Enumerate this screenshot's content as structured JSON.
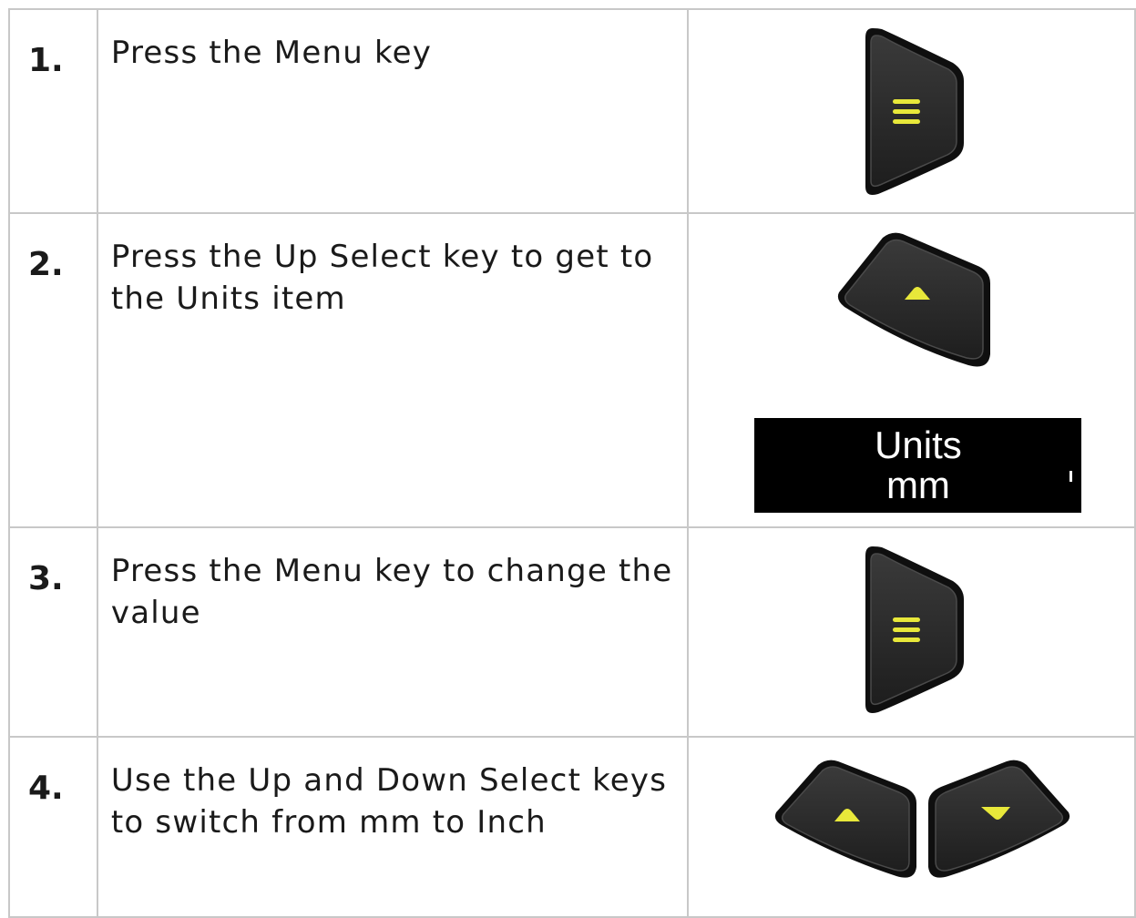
{
  "steps": [
    {
      "number": "1.",
      "text": "Press the Menu key",
      "keys": [
        "menu-key-icon"
      ]
    },
    {
      "number": "2.",
      "text": "Press the Up Select key to get to the Units item",
      "keys": [
        "up-select-key-icon"
      ],
      "display": {
        "line1": "Units",
        "line2": "mm"
      }
    },
    {
      "number": "3.",
      "text": "Press the Menu key to change the value",
      "keys": [
        "menu-key-icon"
      ]
    },
    {
      "number": "4.",
      "text": "Use the Up and Down Select keys to switch from mm to Inch",
      "keys": [
        "up-select-key-icon",
        "down-select-key-icon"
      ]
    }
  ],
  "colors": {
    "key_body": "#2a2a2a",
    "key_rim": "#101010",
    "key_symbol": "#e8e83a",
    "border": "#c8c8c8",
    "lcd_bg": "#000000"
  }
}
